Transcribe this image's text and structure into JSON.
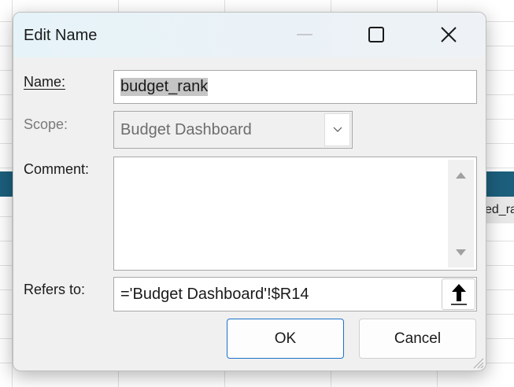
{
  "background": {
    "cell_text": "ed_ra"
  },
  "dialog": {
    "title": "Edit Name",
    "name_label": "Name:",
    "name_value": "budget_rank",
    "scope_label": "Scope:",
    "scope_value": "Budget Dashboard",
    "comment_label": "Comment:",
    "comment_value": "",
    "refers_label": "Refers to:",
    "refers_value": "='Budget Dashboard'!$R14",
    "ok_label": "OK",
    "cancel_label": "Cancel"
  }
}
